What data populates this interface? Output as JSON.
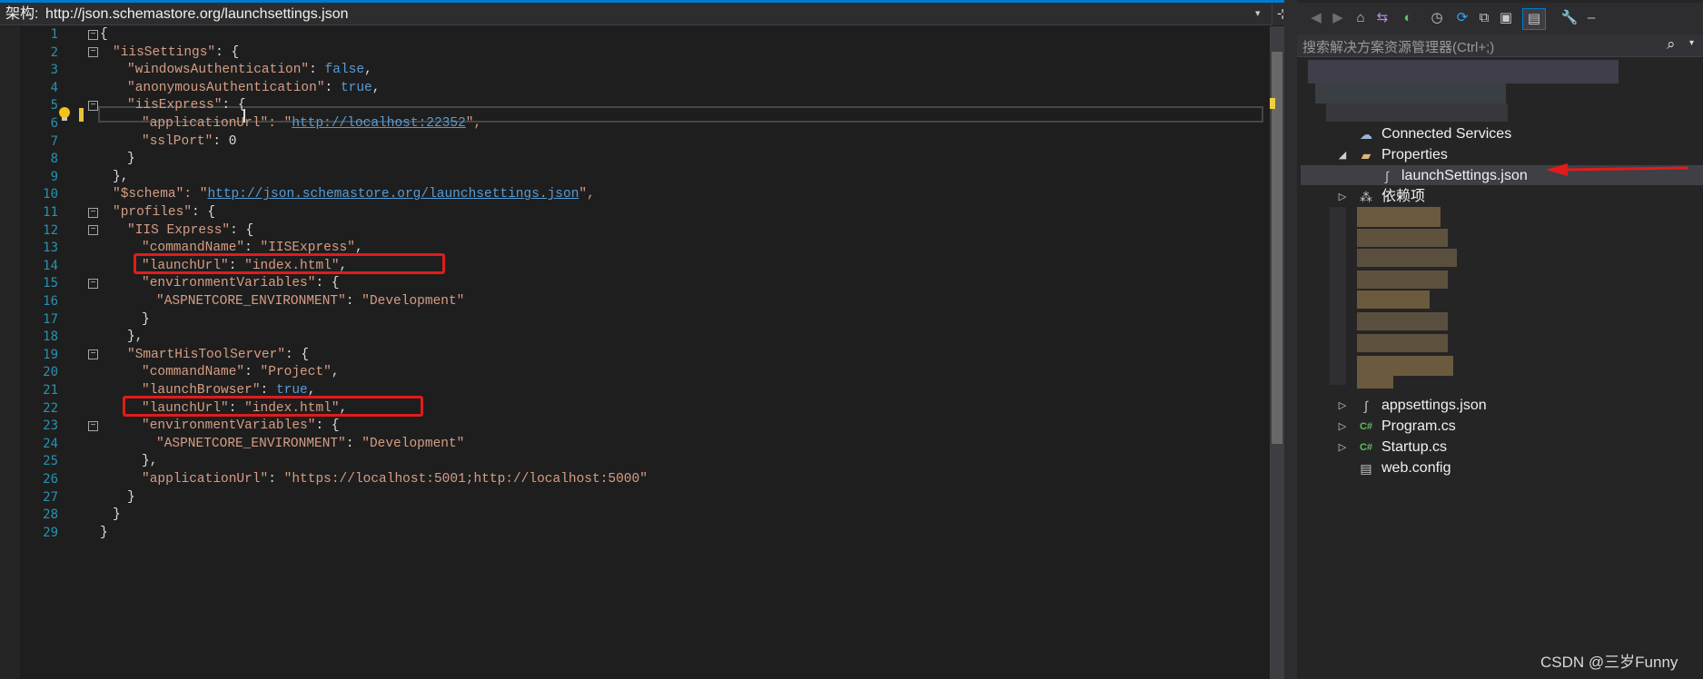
{
  "schema_bar": {
    "label": "架构:",
    "url": "http://json.schemastore.org/launchsettings.json",
    "dropdown_glyph": "▾",
    "split_glyph": "⊹"
  },
  "editor": {
    "lines": [
      {
        "n": "1"
      },
      {
        "n": "2"
      },
      {
        "n": "3"
      },
      {
        "n": "4"
      },
      {
        "n": "5"
      },
      {
        "n": "6"
      },
      {
        "n": "7"
      },
      {
        "n": "8"
      },
      {
        "n": "9"
      },
      {
        "n": "10"
      },
      {
        "n": "11"
      },
      {
        "n": "12"
      },
      {
        "n": "13"
      },
      {
        "n": "14"
      },
      {
        "n": "15"
      },
      {
        "n": "16"
      },
      {
        "n": "17"
      },
      {
        "n": "18"
      },
      {
        "n": "19"
      },
      {
        "n": "20"
      },
      {
        "n": "21"
      },
      {
        "n": "22"
      },
      {
        "n": "23"
      },
      {
        "n": "24"
      },
      {
        "n": "25"
      },
      {
        "n": "26"
      },
      {
        "n": "27"
      },
      {
        "n": "28"
      },
      {
        "n": "29"
      }
    ],
    "code": {
      "l1": "{",
      "l2k": "\"iisSettings\"",
      "l2r": ": {",
      "l3k": "\"windowsAuthentication\"",
      "l3c": ": ",
      "l3v": "false",
      "l3e": ",",
      "l4k": "\"anonymousAuthentication\"",
      "l4c": ": ",
      "l4v": "true",
      "l4e": ",",
      "l5k": "\"iisExpress\"",
      "l5r": ": {",
      "l6k": "\"applicationUrl\"",
      "l6c": ": \"",
      "l6v": "http://localhost:22352",
      "l6e": "\",",
      "l7k": "\"sslPort\"",
      "l7r": ": 0",
      "l8": "}",
      "l9": "},",
      "l10k": "\"$schema\"",
      "l10c": ": \"",
      "l10v": "http://json.schemastore.org/launchsettings.json",
      "l10e": "\",",
      "l11k": "\"profiles\"",
      "l11r": ": {",
      "l12k": "\"IIS Express\"",
      "l12r": ": {",
      "l13k": "\"commandName\"",
      "l13c": ": ",
      "l13v": "\"IISExpress\"",
      "l13e": ",",
      "l14k": "\"launchUrl\"",
      "l14c": ": ",
      "l14v": "\"index.html\"",
      "l14e": ",",
      "l15k": "\"environmentVariables\"",
      "l15r": ": {",
      "l16k": "\"ASPNETCORE_ENVIRONMENT\"",
      "l16c": ": ",
      "l16v": "\"Development\"",
      "l17": "}",
      "l18": "},",
      "l19k": "\"SmartHisToolServer\"",
      "l19r": ": {",
      "l20k": "\"commandName\"",
      "l20c": ": ",
      "l20v": "\"Project\"",
      "l20e": ",",
      "l21k": "\"launchBrowser\"",
      "l21c": ": ",
      "l21v": "true",
      "l21e": ",",
      "l22k": "\"launchUrl\"",
      "l22c": ": ",
      "l22v": "\"index.html\"",
      "l22e": ",",
      "l23k": "\"environmentVariables\"",
      "l23r": ": {",
      "l24k": "\"ASPNETCORE_ENVIRONMENT\"",
      "l24c": ": ",
      "l24v": "\"Development\"",
      "l25": "},",
      "l26k": "\"applicationUrl\"",
      "l26c": ": ",
      "l26v": "\"https://localhost:5001;http://localhost:5000\"",
      "l27": "}",
      "l28": "}",
      "l29": "}"
    },
    "fold_glyph": "−",
    "highlight_color": "#e01c1c"
  },
  "solution_explorer": {
    "search_placeholder": "搜索解决方案资源管理器(Ctrl+;)",
    "search_glyph": "⌕",
    "search_dropdown_glyph": "▾",
    "toolbar": {
      "back": "◀",
      "forward": "▶",
      "home": "⌂",
      "switch_views": "⇆",
      "pending": "◐",
      "history": "◷",
      "sync": "⟳",
      "collapse": "⧉",
      "show_all": "▣",
      "preview": "▤",
      "properties": "🔧",
      "pin": "–"
    },
    "tree": {
      "connected_services": "Connected Services",
      "properties": "Properties",
      "launch_settings": "launchSettings.json",
      "dependencies": "依赖项",
      "appsettings": "appsettings.json",
      "program": "Program.cs",
      "startup": "Startup.cs",
      "web_config": "web.config",
      "expanded_glyph": "◢",
      "collapsed_glyph": "▷"
    },
    "icons": {
      "connected_services": "☁",
      "folder": "▰",
      "json_file": "∫",
      "dependencies": "⁂",
      "csharp": "C#",
      "config": "▤"
    }
  },
  "watermark": "CSDN @三岁Funny"
}
